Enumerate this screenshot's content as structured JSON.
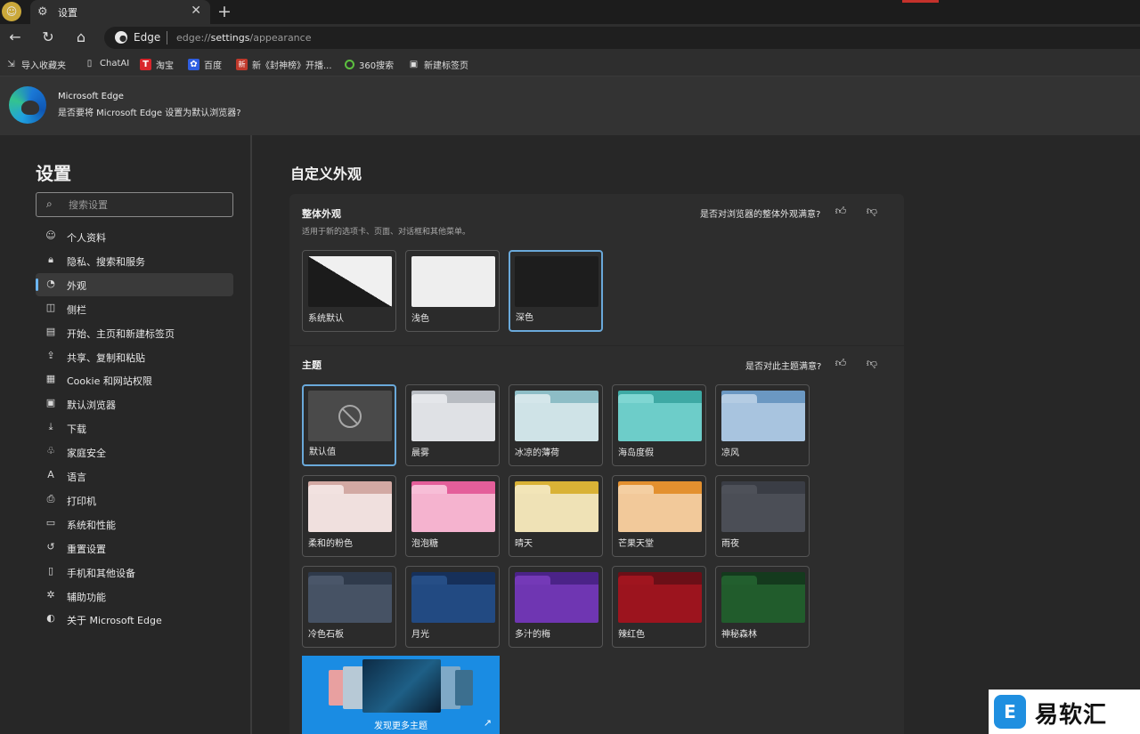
{
  "tab": {
    "title": "设置",
    "close": "✕",
    "new_tab": "+"
  },
  "address": {
    "site": "Edge",
    "url_prefix": "edge://",
    "url_bold": "settings",
    "url_suffix": "/appearance"
  },
  "bookmarks": [
    {
      "label": "导入收藏夹",
      "icon": "import-icon"
    },
    {
      "label": "ChatAI",
      "icon": "page-icon"
    },
    {
      "label": "淘宝",
      "icon": "taobao-icon"
    },
    {
      "label": "百度",
      "icon": "baidu-icon"
    },
    {
      "label": "新《封神榜》开播...",
      "icon": "news-icon"
    },
    {
      "label": "360搜索",
      "icon": "360-icon"
    },
    {
      "label": "新建标签页",
      "icon": "newtab-icon"
    }
  ],
  "banner": {
    "title": "Microsoft Edge",
    "text": "是否要将 Microsoft Edge 设置为默认浏览器?"
  },
  "sidebar": {
    "title": "设置",
    "search_placeholder": "搜索设置",
    "items": [
      {
        "label": "个人资料",
        "icon": "profile-icon",
        "glyph": "☺"
      },
      {
        "label": "隐私、搜索和服务",
        "icon": "lock-icon",
        "glyph": "🔒︎"
      },
      {
        "label": "外观",
        "icon": "appearance-icon",
        "glyph": "◔",
        "active": true
      },
      {
        "label": "侧栏",
        "icon": "sidebar-icon",
        "glyph": "◫"
      },
      {
        "label": "开始、主页和新建标签页",
        "icon": "home-page-icon",
        "glyph": "▤"
      },
      {
        "label": "共享、复制和粘贴",
        "icon": "share-icon",
        "glyph": "⇪"
      },
      {
        "label": "Cookie 和网站权限",
        "icon": "cookie-icon",
        "glyph": "▦"
      },
      {
        "label": "默认浏览器",
        "icon": "browser-icon",
        "glyph": "▣"
      },
      {
        "label": "下载",
        "icon": "download-icon",
        "glyph": "⤓"
      },
      {
        "label": "家庭安全",
        "icon": "family-icon",
        "glyph": "♧"
      },
      {
        "label": "语言",
        "icon": "language-icon",
        "glyph": "A"
      },
      {
        "label": "打印机",
        "icon": "printer-icon",
        "glyph": "⎙"
      },
      {
        "label": "系统和性能",
        "icon": "system-icon",
        "glyph": "▭"
      },
      {
        "label": "重置设置",
        "icon": "reset-icon",
        "glyph": "↺"
      },
      {
        "label": "手机和其他设备",
        "icon": "phone-icon",
        "glyph": "▯"
      },
      {
        "label": "辅助功能",
        "icon": "accessibility-icon",
        "glyph": "✲"
      },
      {
        "label": "关于 Microsoft Edge",
        "icon": "edge-icon",
        "glyph": "◐"
      }
    ]
  },
  "main": {
    "title": "自定义外观",
    "overall": {
      "title": "整体外观",
      "subtitle": "适用于新的选项卡、页面、对话框和其他菜单。",
      "feedback": "是否对浏览器的整体外观满意?",
      "options": [
        {
          "label": "系统默认",
          "kind": "system"
        },
        {
          "label": "浅色",
          "kind": "light"
        },
        {
          "label": "深色",
          "kind": "dark",
          "selected": true
        }
      ]
    },
    "theme": {
      "title": "主题",
      "feedback": "是否对此主题满意?",
      "options": [
        {
          "label": "默认值",
          "kind": "default",
          "selected": true
        },
        {
          "label": "晨雾",
          "top": "#b8bcc2",
          "tab": "#e4e6ea",
          "body": "#dfe1e5"
        },
        {
          "label": "冰凉的薄荷",
          "top": "#8dbdc6",
          "tab": "#d4e6ea",
          "body": "#cfe3e7"
        },
        {
          "label": "海岛度假",
          "top": "#3ea9a4",
          "tab": "#7fd6d2",
          "body": "#6dcdc9"
        },
        {
          "label": "凉风",
          "top": "#6b98c2",
          "tab": "#b4cce3",
          "body": "#a8c4df"
        },
        {
          "label": "柔和的粉色",
          "top": "#d2a9a3",
          "tab": "#f2e2e0",
          "body": "#f0e0de"
        },
        {
          "label": "泡泡糖",
          "top": "#e45e9a",
          "tab": "#f7bed7",
          "body": "#f5b3cf"
        },
        {
          "label": "晴天",
          "top": "#d9b236",
          "tab": "#f2e5b8",
          "body": "#efe2b6"
        },
        {
          "label": "芒果天堂",
          "top": "#e3902f",
          "tab": "#f4cfa2",
          "body": "#f2c99a"
        },
        {
          "label": "雨夜",
          "top": "#3a3d45",
          "tab": "#4e5159",
          "body": "#4b4e56"
        },
        {
          "label": "冷色石板",
          "top": "#2f3a4b",
          "tab": "#4a5669",
          "body": "#465264"
        },
        {
          "label": "月光",
          "top": "#16305a",
          "tab": "#264e86",
          "body": "#224a82"
        },
        {
          "label": "多汁的梅",
          "top": "#4b2388",
          "tab": "#7439b7",
          "body": "#6f36b2"
        },
        {
          "label": "辣红色",
          "top": "#6b0f17",
          "tab": "#a0151f",
          "body": "#9c141e"
        },
        {
          "label": "神秘森林",
          "top": "#143a1d",
          "tab": "#225f2e",
          "body": "#215c2c"
        }
      ],
      "more": "发现更多主题"
    }
  },
  "watermark": {
    "text": "易软汇",
    "icon_char": "E"
  },
  "colors": {
    "accent": "#6aa9da",
    "background": "#272727",
    "card": "#2d2d2d"
  }
}
